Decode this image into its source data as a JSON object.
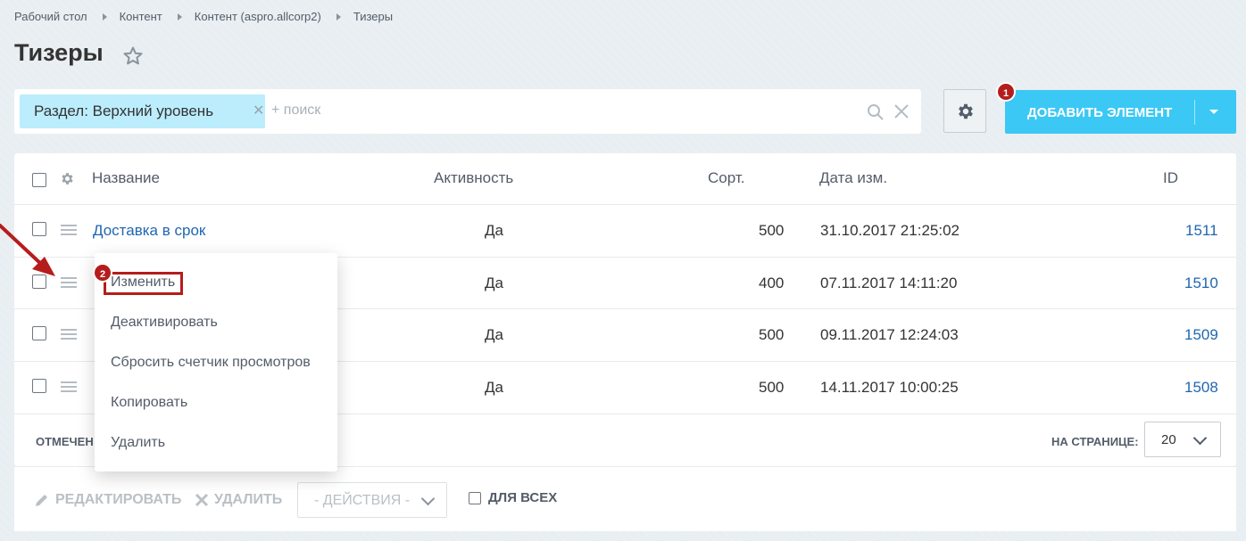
{
  "breadcrumbs": [
    "Рабочий стол",
    "Контент",
    "Контент (aspro.allcorp2)",
    "Тизеры"
  ],
  "page": {
    "title": "Тизеры"
  },
  "filter": {
    "tag_label": "Раздел: Верхний уровень",
    "search_placeholder": "+ поиск"
  },
  "toolbar": {
    "add_label": "ДОБАВИТЬ ЭЛЕМЕНТ"
  },
  "badges": {
    "step1": "1",
    "step2": "2"
  },
  "colors": {
    "accent": "#3bc8f5",
    "link": "#2067b0",
    "highlight": "#b51d1d",
    "tag": "#bcedfc"
  },
  "table": {
    "headers": {
      "name": "Название",
      "active": "Активность",
      "sort": "Сорт.",
      "date": "Дата изм.",
      "id": "ID"
    },
    "rows": [
      {
        "name": "Доставка в срок",
        "active": "Да",
        "sort": "500",
        "date": "31.10.2017 21:25:02",
        "id": "1511"
      },
      {
        "name": "",
        "active": "Да",
        "sort": "400",
        "date": "07.11.2017 14:11:20",
        "id": "1510"
      },
      {
        "name": "",
        "active": "Да",
        "sort": "500",
        "date": "09.11.2017 12:24:03",
        "id": "1509"
      },
      {
        "name": "",
        "active": "Да",
        "sort": "500",
        "date": "14.11.2017 10:00:25",
        "id": "1508"
      }
    ]
  },
  "footer": {
    "selected_label": "ОТМЕЧЕН",
    "per_page_label": "НА СТРАНИЦЕ:",
    "per_page_value": "20"
  },
  "actions": {
    "edit": "РЕДАКТИРОВАТЬ",
    "delete": "УДАЛИТЬ",
    "select": "- ДЕЙСТВИЯ -",
    "for_all": "ДЛЯ ВСЕХ"
  },
  "context_menu": {
    "items": [
      "Изменить",
      "Деактивировать",
      "Сбросить счетчик просмотров",
      "Копировать",
      "Удалить"
    ]
  }
}
